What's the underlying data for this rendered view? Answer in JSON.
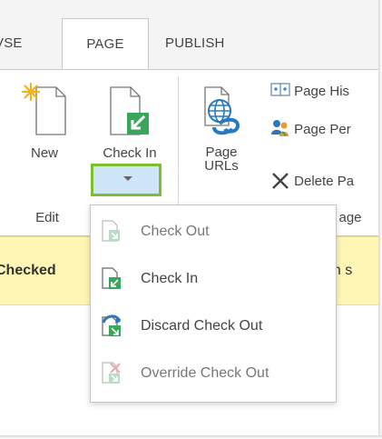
{
  "tabs": [
    {
      "label": "VSE"
    },
    {
      "label": "PAGE"
    },
    {
      "label": "PUBLISH"
    }
  ],
  "ribbon": {
    "new_label": "New",
    "checkin_label": "Check In",
    "page_urls_label_1": "Page",
    "page_urls_label_2": "URLs",
    "page_history": "Page His",
    "page_permissions": "Page Per",
    "delete_page": "Delete Pa",
    "group_edit": "Edit",
    "group_manage": "age"
  },
  "status": {
    "left_text": "Checked",
    "right_text": "can s"
  },
  "menu": {
    "items": [
      {
        "label": "Check Out",
        "icon": "check-out-icon"
      },
      {
        "label": "Check In",
        "icon": "check-in-icon"
      },
      {
        "label": "Discard Check Out",
        "icon": "discard-check-out-icon"
      },
      {
        "label": "Override Check Out",
        "icon": "override-check-out-icon"
      }
    ]
  },
  "colors": {
    "highlight_border": "#7dbe2f",
    "status_bg": "#fff6b5",
    "accent_green": "#3aa55d",
    "accent_blue": "#2a78c2"
  }
}
